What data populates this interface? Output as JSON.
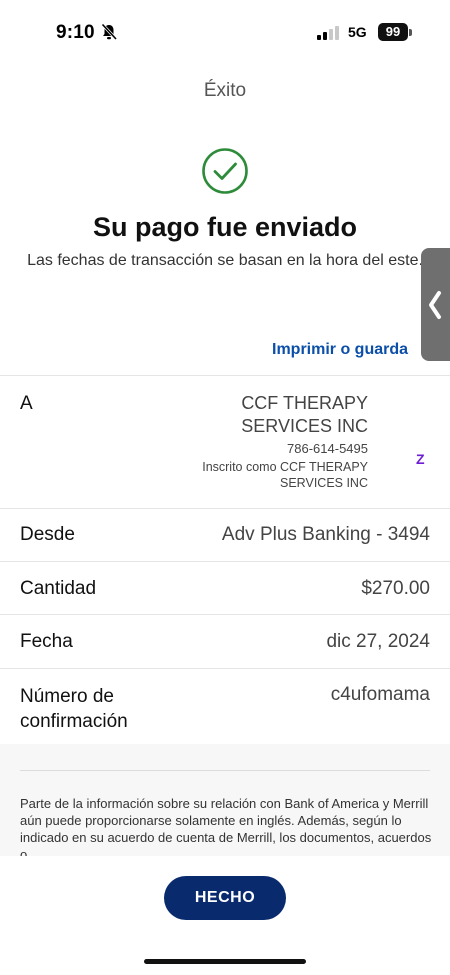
{
  "status_bar": {
    "time": "9:10",
    "network": "5G",
    "battery": "99"
  },
  "header": {
    "title": "Éxito"
  },
  "success": {
    "headline": "Su pago fue enviado",
    "subtitle": "Las fechas de transacción se basan en la hora del este.",
    "print_link": "Imprimir o guarda"
  },
  "details": {
    "payee": {
      "label": "A",
      "name": "CCF THERAPY SERVICES INC",
      "phone": "786-614-5495",
      "enrolled_as": "Inscrito como CCF THERAPY SERVICES INC"
    },
    "from": {
      "label": "Desde",
      "value": "Adv Plus Banking - 3494"
    },
    "amount": {
      "label": "Cantidad",
      "value": "$270.00"
    },
    "date": {
      "label": "Fecha",
      "value": "dic 27, 2024"
    },
    "confirmation": {
      "label": "Número de confirmación",
      "value": "c4ufomama"
    }
  },
  "disclaimer": "Parte de la información sobre su relación con Bank of America y Merrill aún puede proporcionarse solamente en inglés. Además, según lo indicado en su acuerdo de cuenta de Merrill, los documentos, acuerdos o",
  "actions": {
    "done_label": "HECHO"
  },
  "icons": {
    "silent": "bell-slash-icon",
    "signal": "cellular-signal-icon",
    "success": "check-circle-icon",
    "side_tab": "chevron-left-icon",
    "payee_service": "zelle-icon"
  },
  "colors": {
    "success_green": "#2e8b3a",
    "link_blue": "#0b4fa8",
    "button_navy": "#0a2a6e",
    "zelle_purple": "#6d1ed4"
  }
}
